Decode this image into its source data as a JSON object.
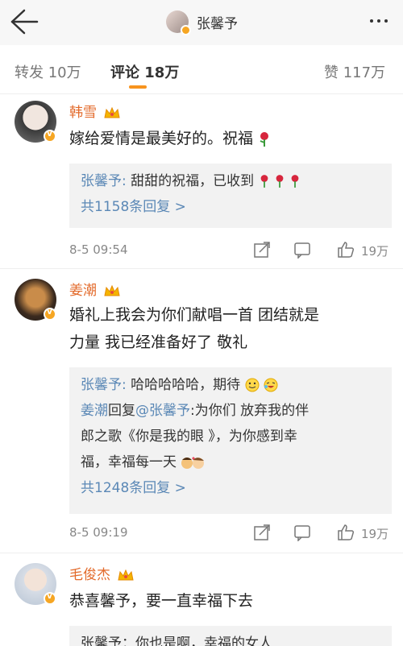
{
  "header": {
    "title": "张馨予",
    "back_icon": "arrow-left-icon",
    "more_icon": "more-dots-icon"
  },
  "tabs": {
    "repost": "转发 10万",
    "comments": "评论 18万",
    "likes": "赞 117万"
  },
  "comments": [
    {
      "name": "韩雪",
      "text": "嫁给爱情是最美好的。祝福",
      "replies": [
        {
          "author": "张馨予",
          "text": "甜甜的祝福，已收到"
        }
      ],
      "more_replies": "共1158条回复 >",
      "date": "8-5 09:54",
      "likes": "19万"
    },
    {
      "name": "姜潮",
      "text_line1": "婚礼上我会为你们献唱一首 团结就是",
      "text_line2": "力量 我已经准备好了 敬礼",
      "replies": [
        {
          "author": "张馨予",
          "text": "哈哈哈哈哈，期待"
        },
        {
          "author": "姜潮",
          "reply_word": "回复",
          "mention": "@张馨予",
          "text_line1": ":为你们 放弃我的伴",
          "text_line2": "郎之歌《你是我的眼 》，为你感到幸",
          "text_line3": "福，幸福每一天"
        }
      ],
      "more_replies": "共1248条回复 >",
      "date": "8-5 09:19",
      "likes": "19万"
    },
    {
      "name": "毛俊杰",
      "text": "恭喜馨予，要一直幸福下去",
      "partial_reply": "张馨予：你也是啊，幸福的女人"
    }
  ],
  "colors": {
    "name_orange": "#e36b2c",
    "link_blue": "#5b88b6",
    "tab_accent": "#f7931e",
    "verified_badge": "#f6a623"
  }
}
